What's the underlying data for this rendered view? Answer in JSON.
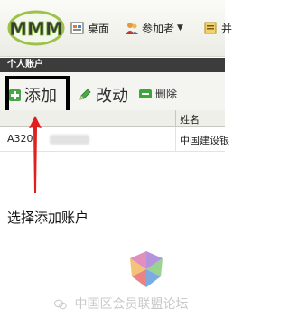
{
  "nav": {
    "desk_label": "桌面",
    "participants_label": "参加者",
    "more_label": "并"
  },
  "section": {
    "title": "个人账户"
  },
  "toolbar": {
    "add_label": "添加",
    "edit_label": "改动",
    "delete_label": "删除"
  },
  "table": {
    "headers": {
      "name": "姓名"
    },
    "rows": [
      {
        "account": "A320",
        "name": "中国建设银"
      }
    ]
  },
  "caption": "选择添加账户",
  "watermark": {
    "text": "中国区会员联盟论坛"
  },
  "colors": {
    "accent_green": "#49a547",
    "arrow_red": "#e0201e",
    "section_bar": "#3c3c3c"
  }
}
